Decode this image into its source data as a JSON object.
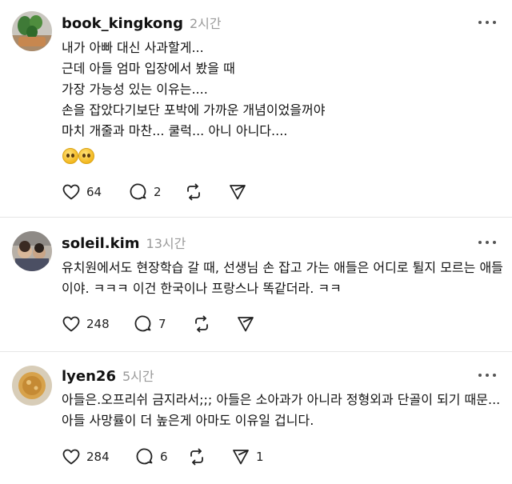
{
  "posts": [
    {
      "username": "book_kingkong",
      "time": "2시간",
      "lines": [
        "내가 아빠 대신 사과할게...",
        "근데 아들 엄마 입장에서 봤을 때",
        "가장 가능성 있는 이유는....",
        "손을 잡았다기보단 포박에 가까운 개념이었을꺼야",
        "마치 개줄과 마찬... 쿨럭... 아니 아니다...."
      ],
      "emoji": "pleading-face-emoji x2",
      "likes": "64",
      "comments": "2",
      "reposts": "",
      "shares": ""
    },
    {
      "username": "soleil.kim",
      "time": "13시간",
      "text": "유치원에서도 현장학습 갈 때, 선생님 손 잡고 가는 애들은 어디로 튈지 모르는 애들이야. ㅋㅋㅋ 이건 한국이나 프랑스나 똑같더라. ㅋㅋ",
      "likes": "248",
      "comments": "7",
      "reposts": "",
      "shares": ""
    },
    {
      "username": "lyen26",
      "time": "5시간",
      "text": "아들은.오프리쉬 금지라서;;; 아들은 소아과가 아니라 정형외과 단골이 되기 때문...아들 사망률이 더 높은게 아마도 이유일 겁니다.",
      "likes": "284",
      "comments": "6",
      "reposts": "",
      "shares": "1"
    }
  ],
  "icons": [
    "heart-icon",
    "comment-icon",
    "repost-icon",
    "share-icon",
    "more-icon"
  ],
  "colors": {
    "text": "#111111",
    "muted": "#9a9a9a",
    "divider": "#e6e6e6"
  }
}
